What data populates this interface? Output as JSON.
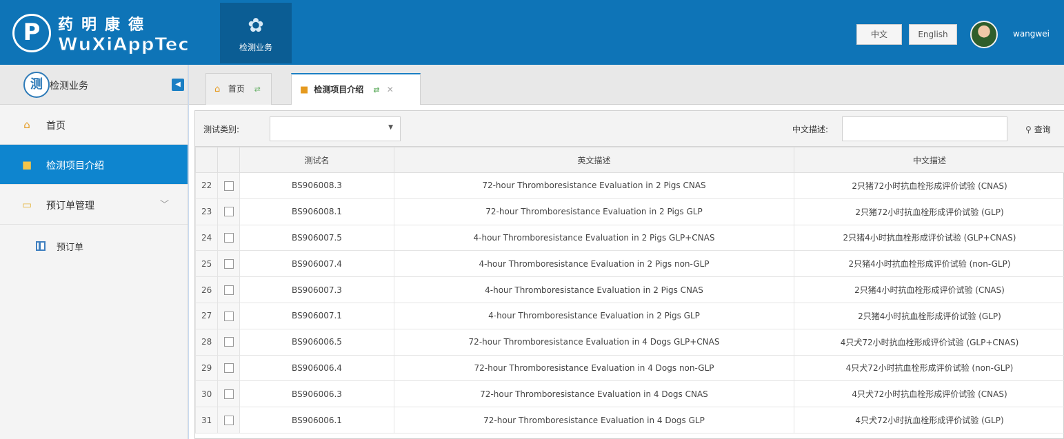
{
  "header": {
    "logo_cn": "药明康德",
    "logo_en": "WuXiAppTec",
    "nav_item": "检测业务",
    "lang_zh": "中文",
    "lang_en": "English",
    "username": "wangwei"
  },
  "sidebar": {
    "title": "检测业务",
    "items": [
      {
        "label": "首页",
        "icon": "home-icon"
      },
      {
        "label": "检测项目介绍",
        "icon": "folder-icon"
      },
      {
        "label": "预订单管理",
        "icon": "monitor-icon"
      }
    ],
    "sub_item": "预订单"
  },
  "tabs": {
    "home": "首页",
    "current": "检测项目介绍"
  },
  "filters": {
    "test_type_label": "测试类别:",
    "test_type_value": "",
    "cn_desc_label": "中文描述:",
    "cn_desc_value": "",
    "search_label": "查询"
  },
  "table": {
    "columns": [
      "测试名",
      "英文描述",
      "中文描述"
    ],
    "rows": [
      {
        "num": "22",
        "code": "BS906008.3",
        "en": "72-hour Thromboresistance Evaluation in 2 Pigs CNAS",
        "cn": "2只猪72小时抗血栓形成评价试验 (CNAS)"
      },
      {
        "num": "23",
        "code": "BS906008.1",
        "en": "72-hour Thromboresistance Evaluation in 2 Pigs GLP",
        "cn": "2只猪72小时抗血栓形成评价试验 (GLP)"
      },
      {
        "num": "24",
        "code": "BS906007.5",
        "en": "4-hour Thromboresistance Evaluation in 2 Pigs GLP+CNAS",
        "cn": "2只猪4小时抗血栓形成评价试验 (GLP+CNAS)"
      },
      {
        "num": "25",
        "code": "BS906007.4",
        "en": "4-hour Thromboresistance Evaluation in 2 Pigs non-GLP",
        "cn": "2只猪4小时抗血栓形成评价试验 (non-GLP)"
      },
      {
        "num": "26",
        "code": "BS906007.3",
        "en": "4-hour Thromboresistance Evaluation in 2 Pigs CNAS",
        "cn": "2只猪4小时抗血栓形成评价试验 (CNAS)"
      },
      {
        "num": "27",
        "code": "BS906007.1",
        "en": "4-hour Thromboresistance Evaluation in 2 Pigs GLP",
        "cn": "2只猪4小时抗血栓形成评价试验 (GLP)"
      },
      {
        "num": "28",
        "code": "BS906006.5",
        "en": "72-hour Thromboresistance Evaluation in 4 Dogs GLP+CNAS",
        "cn": "4只犬72小时抗血栓形成评价试验 (GLP+CNAS)"
      },
      {
        "num": "29",
        "code": "BS906006.4",
        "en": "72-hour Thromboresistance Evaluation in 4 Dogs non-GLP",
        "cn": "4只犬72小时抗血栓形成评价试验 (non-GLP)"
      },
      {
        "num": "30",
        "code": "BS906006.3",
        "en": "72-hour Thromboresistance Evaluation in 4 Dogs CNAS",
        "cn": "4只犬72小时抗血栓形成评价试验 (CNAS)"
      },
      {
        "num": "31",
        "code": "BS906006.1",
        "en": "72-hour Thromboresistance Evaluation in 4 Dogs GLP",
        "cn": "4只犬72小时抗血栓形成评价试验 (GLP)"
      }
    ]
  },
  "colors": {
    "header_bg": "#0e74b7",
    "active_item": "#0e85cf",
    "page_bg": "#c9daf0"
  }
}
